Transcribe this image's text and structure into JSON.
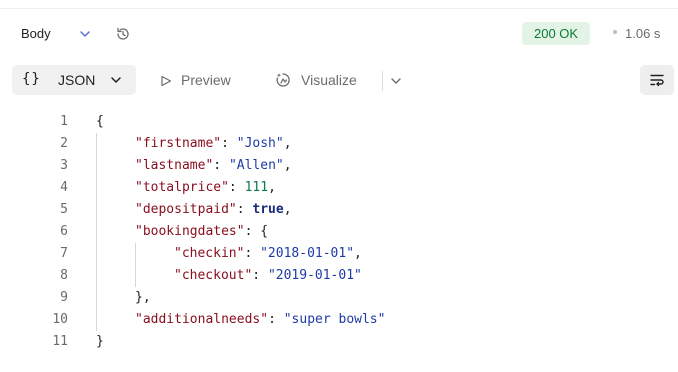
{
  "header": {
    "body_label": "Body",
    "status": "200 OK",
    "time": "1.06 s"
  },
  "toolbar": {
    "json_braces": "{}",
    "json_label": "JSON",
    "preview_label": "Preview",
    "visualize_label": "Visualize"
  },
  "code": {
    "line_numbers": [
      "1",
      "2",
      "3",
      "4",
      "5",
      "6",
      "7",
      "8",
      "9",
      "10",
      "11"
    ],
    "open_brace": "{",
    "close_brace": "}",
    "firstname_key": "\"firstname\"",
    "firstname_value": "\"Josh\"",
    "lastname_key": "\"lastname\"",
    "lastname_value": "\"Allen\"",
    "totalprice_key": "\"totalprice\"",
    "totalprice_value": "111",
    "depositpaid_key": "\"depositpaid\"",
    "depositpaid_value": "true",
    "bookingdates_key": "\"bookingdates\"",
    "checkin_key": "\"checkin\"",
    "checkin_value": "\"2018-01-01\"",
    "checkout_key": "\"checkout\"",
    "checkout_value": "\"2019-01-01\"",
    "inner_close": "},",
    "additionalneeds_key": "\"additionalneeds\"",
    "additionalneeds_value": "\"super bowls\""
  },
  "colors": {
    "status_bg": "#e3f3e6",
    "status_text": "#0b7a33",
    "key": "#880e1d",
    "string": "#1e3aa6",
    "number": "#0f7a4a"
  },
  "icons": [
    "chevron-down-icon",
    "history-icon",
    "play-outline-icon",
    "visualize-icon",
    "wrap-lines-icon"
  ]
}
